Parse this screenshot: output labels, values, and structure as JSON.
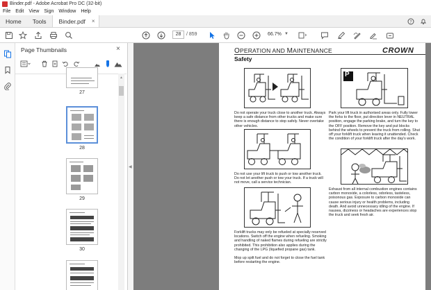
{
  "window": {
    "title": "Binder.pdf - Adobe Acrobat Pro DC (32-bit)"
  },
  "menu": [
    "File",
    "Edit",
    "View",
    "Sign",
    "Window",
    "Help"
  ],
  "tabs": {
    "home": "Home",
    "tools": "Tools",
    "doc": "Binder.pdf",
    "close": "×"
  },
  "nav": {
    "page": "28",
    "total": "/ 859",
    "zoom": "66.7%"
  },
  "panel": {
    "title": "Page Thumbnails",
    "close": "×"
  },
  "thumbs": [
    {
      "label": "27"
    },
    {
      "label": "28"
    },
    {
      "label": "29"
    },
    {
      "label": "30"
    },
    {
      "label": ""
    }
  ],
  "page": {
    "title_o": "O",
    "title_rest1": "PERATION AND ",
    "title_m": "M",
    "title_rest2": "AINTENANCE",
    "brand": "CROWN",
    "subtitle": "Safety",
    "p_sign": "P",
    "text1": "Do not operate your truck close to another truck. Always keep a safe distance from other trucks and make sure there is enough distance to stop safely. Never overtake other vehicles.",
    "text2": "Park your lift truck in authorised areas only. Fully lower the forks to the floor, put direction lever in NEUTRAL position, engage the parking brake, and turn the key to the OFF position. Remove the key and put blocks behind the wheels to prevent the truck from rolling. Shut off your forklift truck when leaving it unattended. Check the condition of your forklift truck after the day's work.",
    "text3": "Do not use your lift truck to push or tow another truck. Do not let another push or tow your truck. If a truck will not move, call a service technician.",
    "text4": "Exhaust from all internal combustion engines contains carbon monoxide, a colorless, odorless, tasteless, poisonous gas. Exposure to carbon monoxide can cause serious injury or health problems, including death. And avoid unnecessary idling of the engine. If nausea, dizziness or headaches are experiences stop the truck and seek fresh air.",
    "text5": "Forklift trucks may only be refueled at specially reserved locations. Switch off the engine when refueling. Smoking and handling of naked flames during refueling are strictly prohibited. This prohibition also applies during the changing of the LPG (liquefied propane gas) tank.",
    "text6": "Mop up spilt fuel and do not forget to close the fuel tank before restarting the engine."
  }
}
